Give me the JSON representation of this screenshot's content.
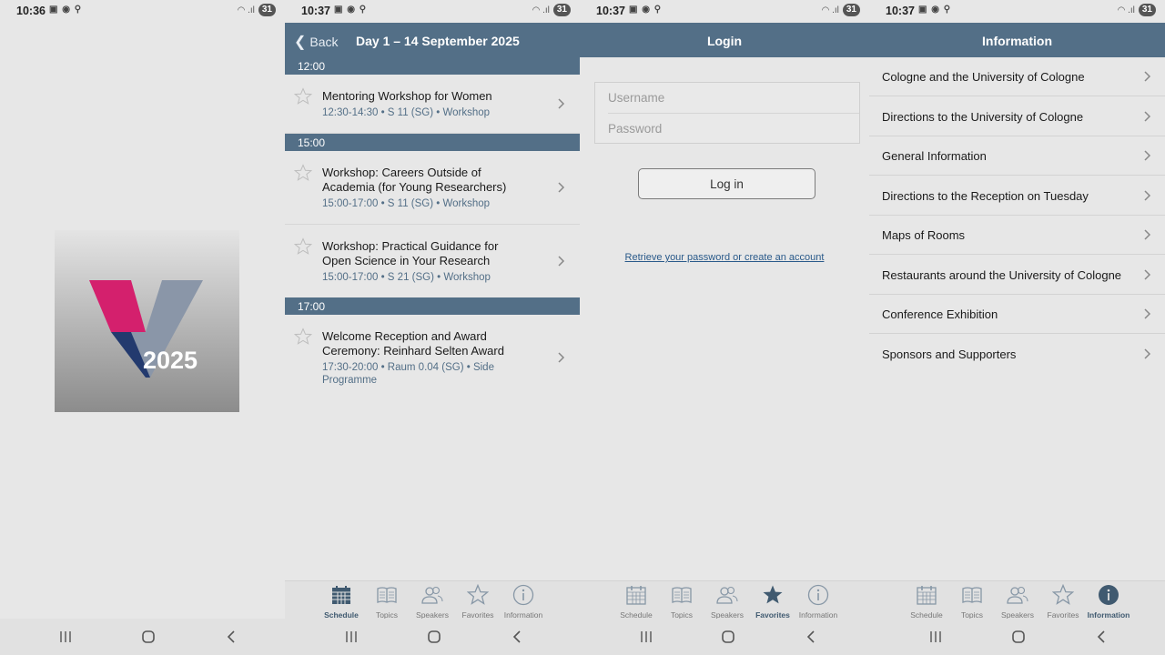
{
  "colors": {
    "header": "#536f87",
    "accent": "#405a70",
    "link": "#2a5a8a"
  },
  "screens": {
    "splash": {
      "status": {
        "time": "10:36",
        "battery": "31"
      },
      "logo": {
        "text": "2025",
        "colors": [
          "#d4206d",
          "#8a96a8",
          "#233a6e"
        ]
      }
    },
    "schedule": {
      "status": {
        "time": "10:37",
        "battery": "31"
      },
      "back_label": "Back",
      "title": "Day 1 – 14 September 2025",
      "sections": [
        {
          "time": "12:00",
          "events": [
            {
              "title": "Mentoring Workshop for Women",
              "meta": "12:30-14:30 • S 11 (SG) • Workshop"
            }
          ]
        },
        {
          "time": "15:00",
          "events": [
            {
              "title": "Workshop: Careers Outside of Academia (for Young Researchers)",
              "meta": "15:00-17:00 • S 11 (SG) • Workshop"
            },
            {
              "title": "Workshop: Practical Guidance for Open Science in Your Research",
              "meta": "15:00-17:00 • S 21 (SG) • Workshop"
            }
          ]
        },
        {
          "time": "17:00",
          "events": [
            {
              "title": "Welcome Reception and Award Ceremony: Reinhard Selten Award",
              "meta": "17:30-20:00 • Raum 0.04 (SG) • Side Programme"
            }
          ]
        }
      ],
      "active_tab": "Schedule"
    },
    "login": {
      "status": {
        "time": "10:37",
        "battery": "31"
      },
      "title": "Login",
      "username_placeholder": "Username",
      "password_placeholder": "Password",
      "login_button": "Log in",
      "retrieve_link": "Retrieve your password or create an account",
      "active_tab": "Favorites"
    },
    "information": {
      "status": {
        "time": "10:37",
        "battery": "31"
      },
      "title": "Information",
      "items": [
        "Cologne and the University of Cologne",
        "Directions to the University of Cologne",
        "General Information",
        "Directions to the Reception on Tuesday",
        "Maps of Rooms",
        "Restaurants around the University of Cologne",
        "Conference Exhibition",
        "Sponsors and Supporters"
      ],
      "active_tab": "Information"
    }
  },
  "tabs": [
    {
      "label": "Schedule",
      "icon": "calendar-icon"
    },
    {
      "label": "Topics",
      "icon": "book-icon"
    },
    {
      "label": "Speakers",
      "icon": "people-icon"
    },
    {
      "label": "Favorites",
      "icon": "star-icon"
    },
    {
      "label": "Information",
      "icon": "info-icon"
    }
  ]
}
